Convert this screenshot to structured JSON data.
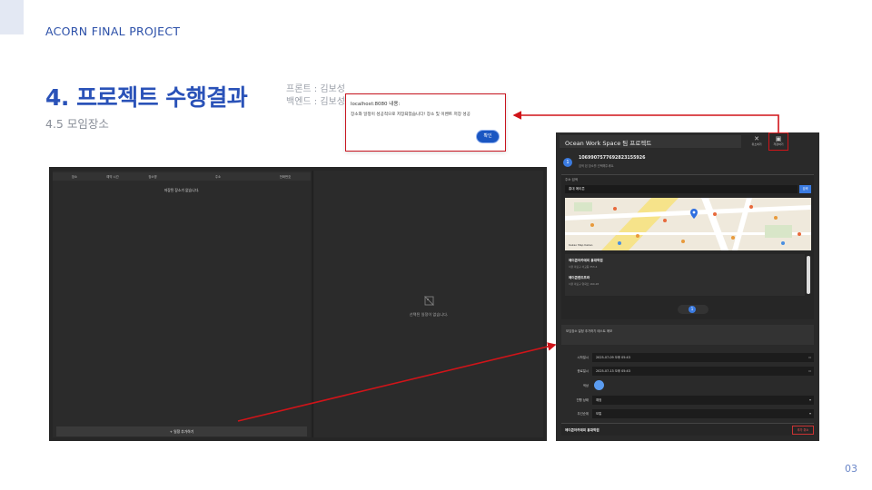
{
  "header": {
    "project_label": "ACORN FINAL PROJECT",
    "title": "4. 프로젝트 수행결과",
    "subtitle": "4.5 모임장소",
    "credit_front": "프론트 : 김보성",
    "credit_back": "백엔드 : 김보성"
  },
  "page_number": "03",
  "alert": {
    "title": "localhost:8080 내용:",
    "message": "장소와 일정이 성공적으로 저장되었습니다! 장소 및 이벤트 저장 성공",
    "ok_label": "확인"
  },
  "left_screen": {
    "columns": [
      "장소",
      "예약 시간",
      "장소명",
      "주소",
      "전화번호"
    ],
    "empty_list": "저장된 장소가 없습니다.",
    "add_button": "+ 일정 추가하기",
    "empty_detail": "선택된 일정이 없습니다."
  },
  "right_screen": {
    "workspace_title": "Ocean Work Space 팀 프로젝트",
    "cancel_label": "취소하기",
    "save_label": "저장하기",
    "step_number": "1",
    "phone": "1069907577692823155926",
    "phone_sub": "검색 된 장소를 선택해주세요.",
    "search_label": "주소 검색",
    "search_value": "홍대 에이콘",
    "search_button": "검색",
    "map_attribution": "Kakao  Map  Kakao",
    "results": [
      {
        "name": "에이콘아카데미 홍대학원",
        "address": "서울 마포구 서교동 353-4"
      },
      {
        "name": "에이콘랜드프라",
        "address": "서울 마포구 양화로 160-28"
      }
    ],
    "page_current": "1",
    "memo": "모임장소 일정 추가하기 테스트 메모",
    "fields": [
      {
        "label": "시작일시",
        "value": "2025-07-09 오후 05:43"
      },
      {
        "label": "종료일시",
        "value": "2025-07-13 오후 05:43"
      },
      {
        "label": "색상",
        "value": ""
      },
      {
        "label": "진행 상태",
        "value": "예정"
      },
      {
        "label": "우선순위",
        "value": "보통"
      }
    ],
    "footer_place": "에이콘아카데미 홍대학원",
    "footer_button": "추가 취소"
  }
}
